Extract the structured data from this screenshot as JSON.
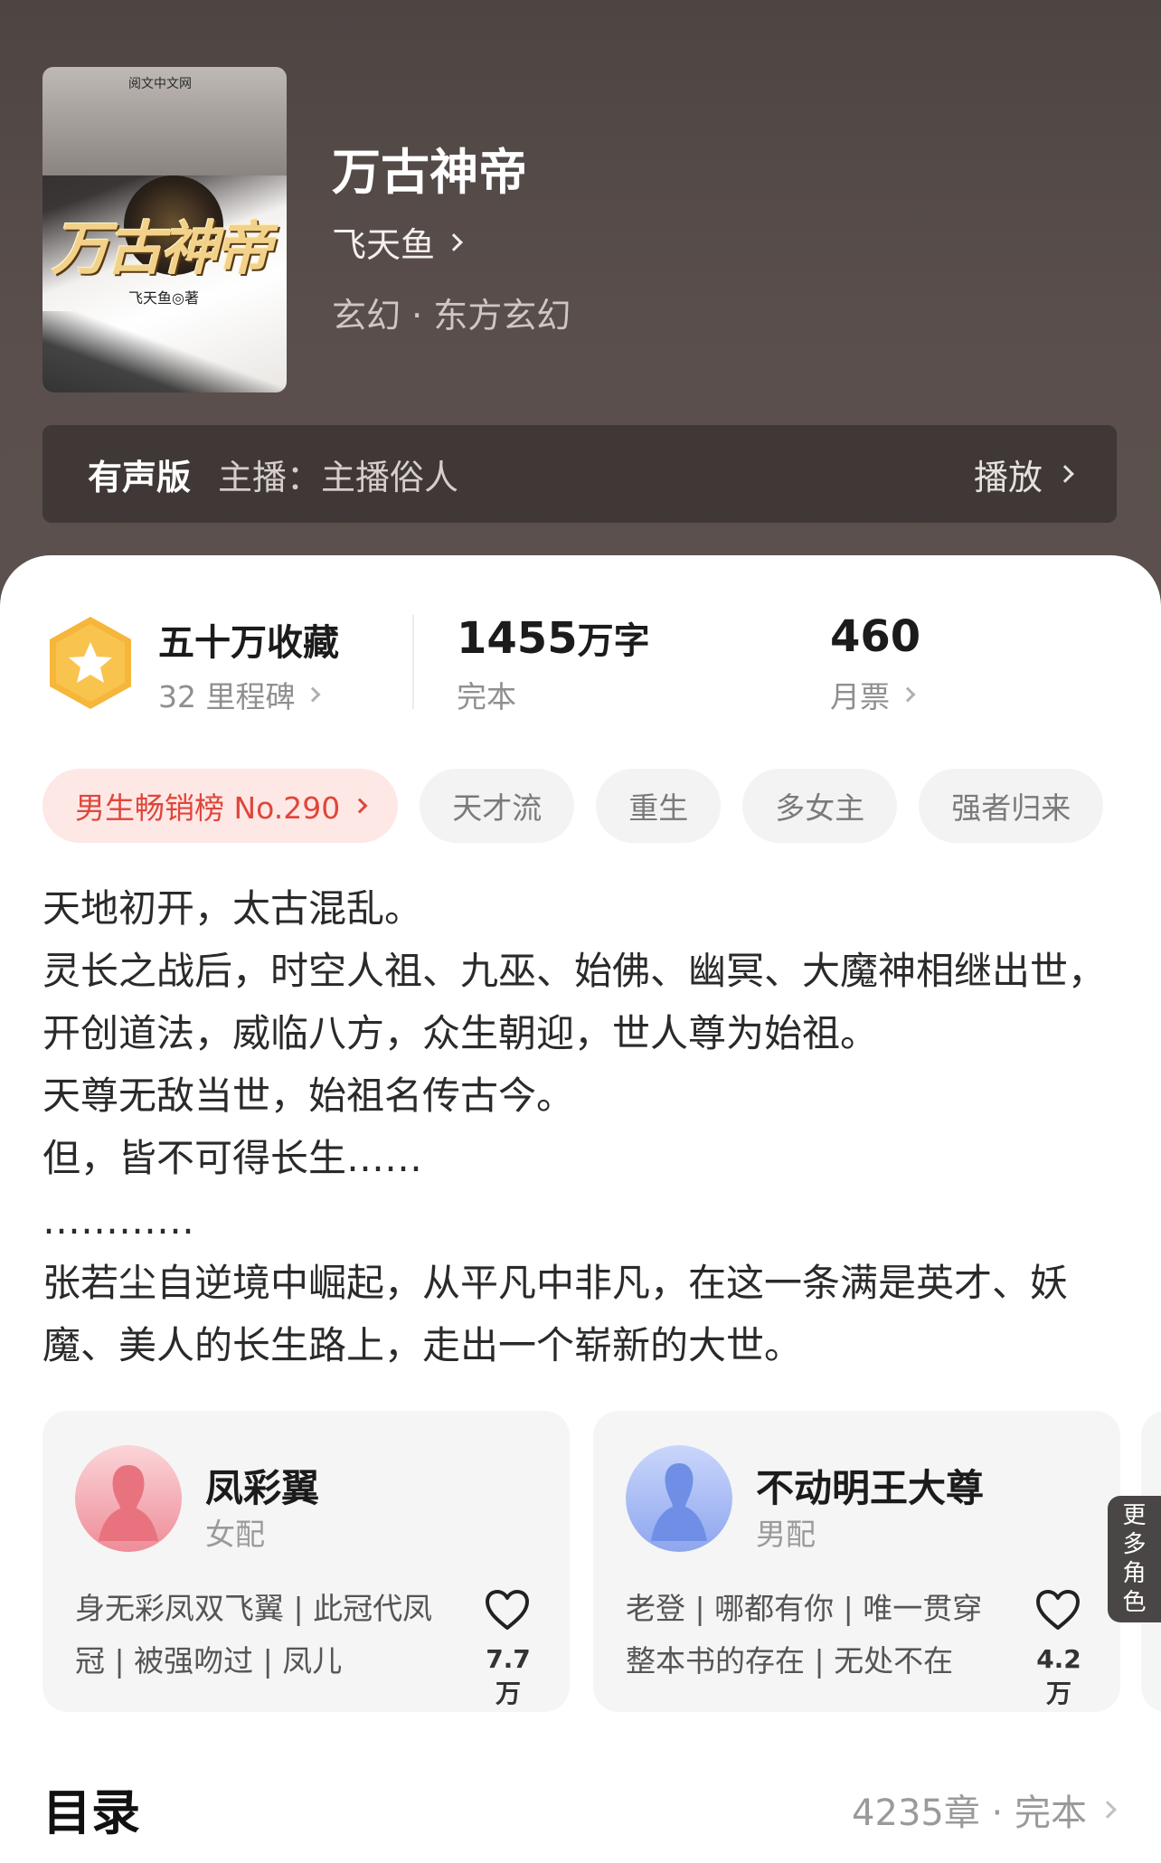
{
  "book": {
    "title": "万古神帝",
    "author": "飞天鱼",
    "category": "玄幻 · 东方玄幻",
    "cover": {
      "publisher": "阅文中文网",
      "title_art": "万古神帝",
      "author_line": "飞天鱼◎著"
    }
  },
  "audio": {
    "label": "有声版",
    "host": "主播：主播俗人",
    "play_label": "播放"
  },
  "stats": {
    "favorites": "五十万收藏",
    "milestones": "32 里程碑",
    "word_count": "1455",
    "word_unit": "万字",
    "status": "完本",
    "monthly_votes": "460",
    "monthly_votes_label": "月票"
  },
  "tags": {
    "rank": "男生畅销榜 No.290",
    "items": [
      "天才流",
      "重生",
      "多女主",
      "强者归来"
    ]
  },
  "description": [
    "天地初开，太古混乱。",
    "灵长之战后，时空人祖、九巫、始佛、幽冥、大魔神相继出世，开创道法，威临八方，众生朝迎，世人尊为始祖。",
    "天尊无敌当世，始祖名传古今。",
    "但，皆不可得长生……",
    "…………",
    "张若尘自逆境中崛起，从平凡中非凡，在这一条满是英才、妖魔、美人的长生路上，走出一个崭新的大世。"
  ],
  "roles": [
    {
      "name": "凤彩翼",
      "type": "女配",
      "desc": "身无彩凤双飞翼 | 此冠代凤冠 | 被强吻过 | 凤儿",
      "likes": "7.7万",
      "avatar_color": "#f0a5ad"
    },
    {
      "name": "不动明王大尊",
      "type": "男配",
      "desc": "老登 | 哪都有你 | 唯一贯穿整本书的存在 | 无处不在",
      "likes": "4.2万",
      "avatar_color": "#9fb4f0"
    }
  ],
  "more_roles": "更多角色",
  "toc": {
    "title": "目录",
    "info": "4235章 · 完本"
  },
  "colors": {
    "accent_red": "#e0463b",
    "badge_gold": "#f5b63a"
  }
}
